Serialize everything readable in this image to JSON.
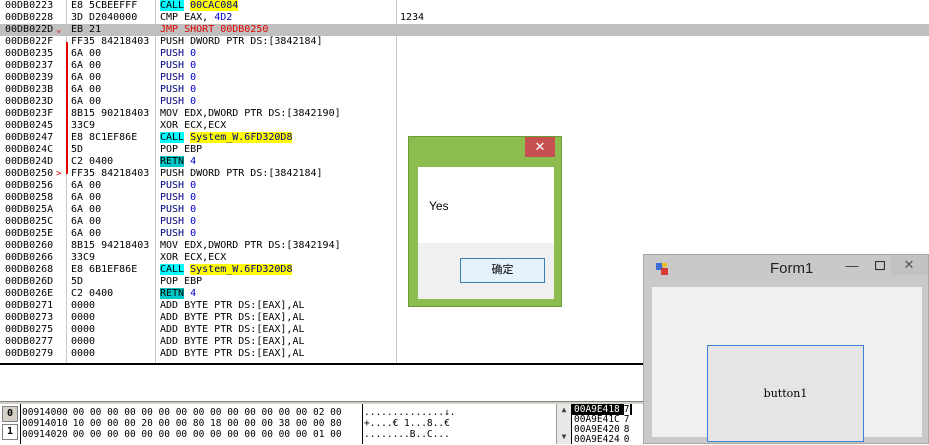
{
  "disasm": {
    "rows": [
      {
        "addr": "00DB0223",
        "arrow": "",
        "hex": "E8 5CBEEFFF",
        "op": "CALL",
        "arg": "00CAC084",
        "kind": "call",
        "comment": ""
      },
      {
        "addr": "00DB0228",
        "arrow": "",
        "hex": "3D D2040000",
        "op": "CMP EAX,",
        "arg": "4D2",
        "kind": "cmp",
        "comment": "1234"
      },
      {
        "addr": "00DB022D",
        "arrow": "⌄",
        "hex": "EB 21",
        "op": "JMP SHORT",
        "arg": "00DB0250",
        "kind": "jmp",
        "comment": ""
      },
      {
        "addr": "00DB022F",
        "arrow": "",
        "hex": "FF35 84218403",
        "op": "PUSH DWORD PTR DS:[3842184]",
        "arg": "",
        "kind": "plain",
        "comment": ""
      },
      {
        "addr": "00DB0235",
        "arrow": "",
        "hex": "6A 00",
        "op": "PUSH",
        "arg": "0",
        "kind": "imm",
        "comment": ""
      },
      {
        "addr": "00DB0237",
        "arrow": "",
        "hex": "6A 00",
        "op": "PUSH",
        "arg": "0",
        "kind": "imm",
        "comment": ""
      },
      {
        "addr": "00DB0239",
        "arrow": "",
        "hex": "6A 00",
        "op": "PUSH",
        "arg": "0",
        "kind": "imm",
        "comment": ""
      },
      {
        "addr": "00DB023B",
        "arrow": "",
        "hex": "6A 00",
        "op": "PUSH",
        "arg": "0",
        "kind": "imm",
        "comment": ""
      },
      {
        "addr": "00DB023D",
        "arrow": "",
        "hex": "6A 00",
        "op": "PUSH",
        "arg": "0",
        "kind": "imm",
        "comment": ""
      },
      {
        "addr": "00DB023F",
        "arrow": "",
        "hex": "8B15 90218403",
        "op": "MOV EDX,DWORD PTR DS:[3842190]",
        "arg": "",
        "kind": "plain",
        "comment": ""
      },
      {
        "addr": "00DB0245",
        "arrow": "",
        "hex": "33C9",
        "op": "XOR ECX,ECX",
        "arg": "",
        "kind": "plain",
        "comment": ""
      },
      {
        "addr": "00DB0247",
        "arrow": "",
        "hex": "E8 8C1EF86E",
        "op": "CALL",
        "arg": "System_W.6FD320D8",
        "kind": "call",
        "comment": ""
      },
      {
        "addr": "00DB024C",
        "arrow": "",
        "hex": "5D",
        "op": "POP EBP",
        "arg": "",
        "kind": "plain",
        "comment": ""
      },
      {
        "addr": "00DB024D",
        "arrow": "",
        "hex": "C2 0400",
        "op": "RETN",
        "arg": "4",
        "kind": "ret",
        "comment": ""
      },
      {
        "addr": "00DB0250",
        "arrow": ">",
        "hex": "FF35 84218403",
        "op": "PUSH DWORD PTR DS:[3842184]",
        "arg": "",
        "kind": "plain",
        "comment": ""
      },
      {
        "addr": "00DB0256",
        "arrow": "",
        "hex": "6A 00",
        "op": "PUSH",
        "arg": "0",
        "kind": "imm",
        "comment": ""
      },
      {
        "addr": "00DB0258",
        "arrow": "",
        "hex": "6A 00",
        "op": "PUSH",
        "arg": "0",
        "kind": "imm",
        "comment": ""
      },
      {
        "addr": "00DB025A",
        "arrow": "",
        "hex": "6A 00",
        "op": "PUSH",
        "arg": "0",
        "kind": "imm",
        "comment": ""
      },
      {
        "addr": "00DB025C",
        "arrow": "",
        "hex": "6A 00",
        "op": "PUSH",
        "arg": "0",
        "kind": "imm",
        "comment": ""
      },
      {
        "addr": "00DB025E",
        "arrow": "",
        "hex": "6A 00",
        "op": "PUSH",
        "arg": "0",
        "kind": "imm",
        "comment": ""
      },
      {
        "addr": "00DB0260",
        "arrow": "",
        "hex": "8B15 94218403",
        "op": "MOV EDX,DWORD PTR DS:[3842194]",
        "arg": "",
        "kind": "plain",
        "comment": ""
      },
      {
        "addr": "00DB0266",
        "arrow": "",
        "hex": "33C9",
        "op": "XOR ECX,ECX",
        "arg": "",
        "kind": "plain",
        "comment": ""
      },
      {
        "addr": "00DB0268",
        "arrow": "",
        "hex": "E8 6B1EF86E",
        "op": "CALL",
        "arg": "System_W.6FD320D8",
        "kind": "call",
        "comment": ""
      },
      {
        "addr": "00DB026D",
        "arrow": "",
        "hex": "5D",
        "op": "POP EBP",
        "arg": "",
        "kind": "plain",
        "comment": ""
      },
      {
        "addr": "00DB026E",
        "arrow": "",
        "hex": "C2 0400",
        "op": "RETN",
        "arg": "4",
        "kind": "ret",
        "comment": ""
      },
      {
        "addr": "00DB0271",
        "arrow": "",
        "hex": "0000",
        "op": "ADD BYTE PTR DS:[EAX],AL",
        "arg": "",
        "kind": "plain",
        "comment": ""
      },
      {
        "addr": "00DB0273",
        "arrow": "",
        "hex": "0000",
        "op": "ADD BYTE PTR DS:[EAX],AL",
        "arg": "",
        "kind": "plain",
        "comment": ""
      },
      {
        "addr": "00DB0275",
        "arrow": "",
        "hex": "0000",
        "op": "ADD BYTE PTR DS:[EAX],AL",
        "arg": "",
        "kind": "plain",
        "comment": ""
      },
      {
        "addr": "00DB0277",
        "arrow": "",
        "hex": "0000",
        "op": "ADD BYTE PTR DS:[EAX],AL",
        "arg": "",
        "kind": "plain",
        "comment": ""
      },
      {
        "addr": "00DB0279",
        "arrow": "",
        "hex": "0000",
        "op": "ADD BYTE PTR DS:[EAX],AL",
        "arg": "",
        "kind": "plain",
        "comment": ""
      }
    ]
  },
  "dump": {
    "tabs": [
      "0",
      "1"
    ],
    "rows": [
      {
        "addr": "00914000",
        "bytes": "00 00 00 00 00 00 00 00 00 00 00 00 00 00 02 00",
        "ascii": "..............↓."
      },
      {
        "addr": "00914010",
        "bytes": "10 00 00 00 20 00 00 80 18 00 00 00 38 00 00 80",
        "ascii": "+....€ 1...8..€"
      },
      {
        "addr": "00914020",
        "bytes": "00 00 00 00 00 00 00 00 00 00 00 00 00 00 01 00",
        "ascii": "........B..C..."
      }
    ]
  },
  "stack": {
    "rows": [
      {
        "addr": "00A9E418",
        "val": "7"
      },
      {
        "addr": "00A9E41C",
        "val": "7"
      },
      {
        "addr": "00A9E420",
        "val": "8"
      },
      {
        "addr": "00A9E424",
        "val": "0"
      }
    ]
  },
  "msgbox": {
    "close_glyph": "✕",
    "text": "Yes",
    "ok_label": "确定"
  },
  "form1": {
    "title": "Form1",
    "min_glyph": "—",
    "close_glyph": "✕",
    "button_label": "button1"
  }
}
